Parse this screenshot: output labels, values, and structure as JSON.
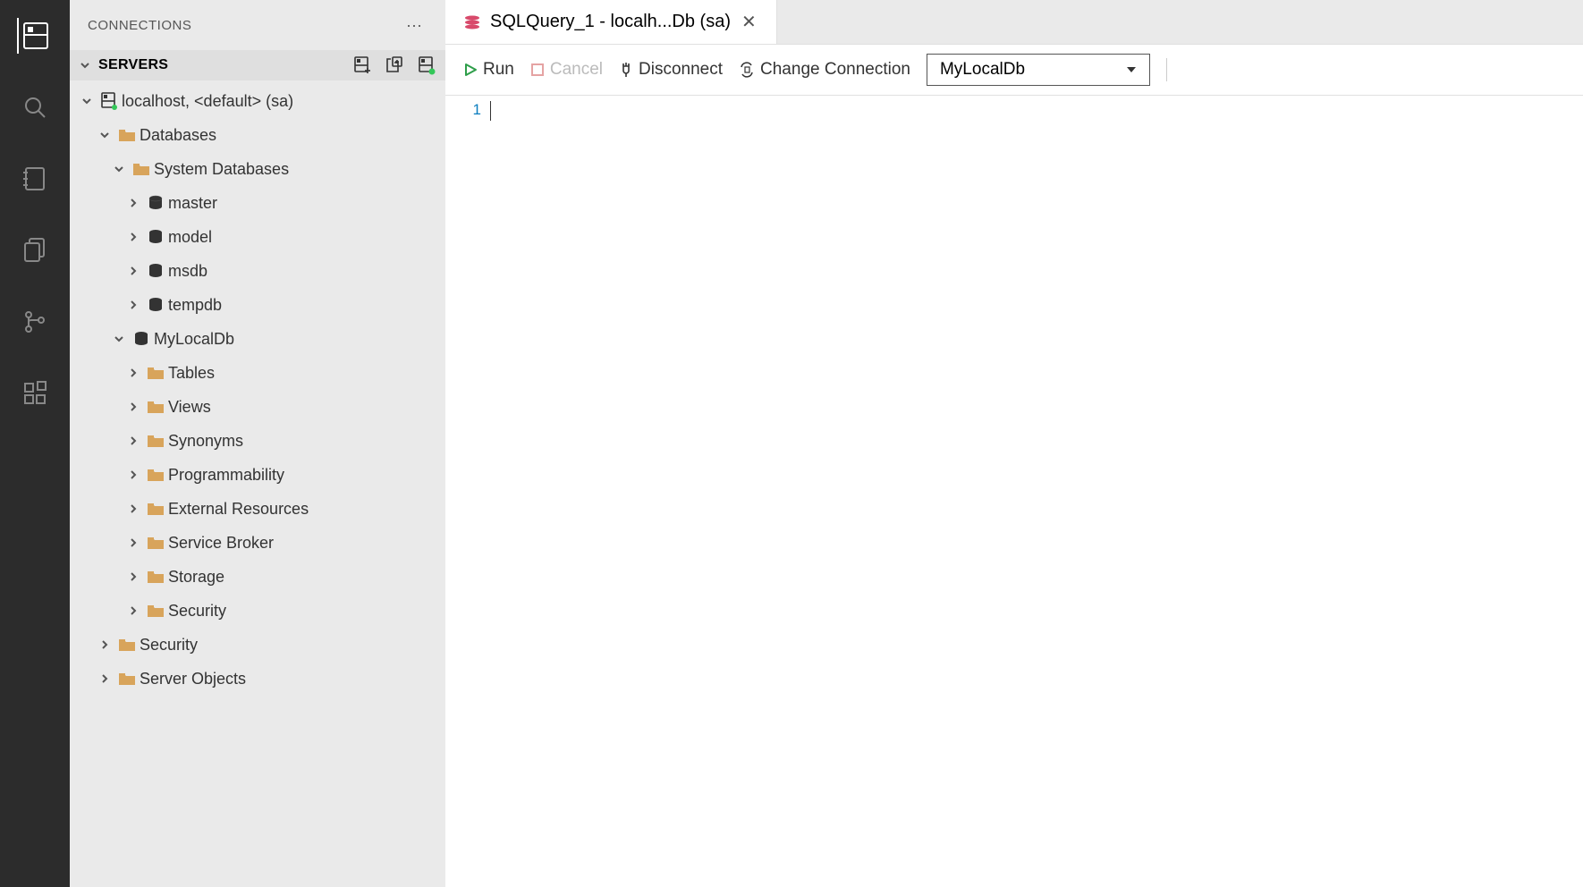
{
  "sidebar": {
    "title": "CONNECTIONS",
    "servers_title": "SERVERS"
  },
  "tree": {
    "server": "localhost, <default> (sa)",
    "databases": "Databases",
    "system_databases": "System Databases",
    "sys_dbs": [
      "master",
      "model",
      "msdb",
      "tempdb"
    ],
    "my_db": "MyLocalDb",
    "db_children": [
      "Tables",
      "Views",
      "Synonyms",
      "Programmability",
      "External Resources",
      "Service Broker",
      "Storage",
      "Security"
    ],
    "server_children": [
      "Security",
      "Server Objects"
    ]
  },
  "tab": {
    "label": "SQLQuery_1 - localh...Db (sa)"
  },
  "toolbar": {
    "run": "Run",
    "cancel": "Cancel",
    "disconnect": "Disconnect",
    "change_connection": "Change Connection",
    "db_selected": "MyLocalDb"
  },
  "editor": {
    "line_number": "1"
  }
}
